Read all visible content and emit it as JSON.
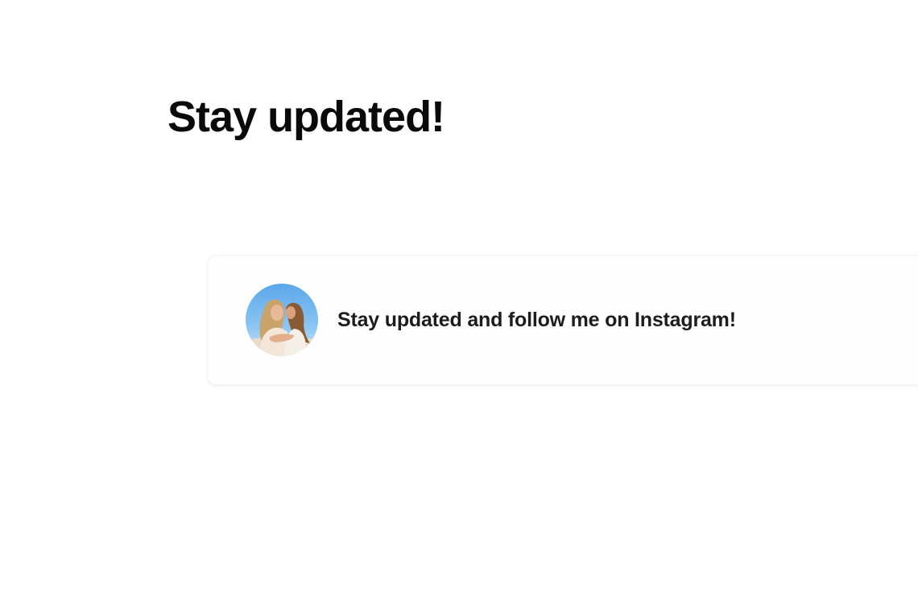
{
  "section": {
    "title": "Stay updated!"
  },
  "card": {
    "text": "Stay updated and follow me on Instagram!",
    "avatar_icon": "profile-photo-avatar"
  },
  "colors": {
    "background": "#ffffff",
    "title_text": "#0a0a0a",
    "card_text": "#1d1d1f",
    "card_border": "#f3f3f3"
  }
}
